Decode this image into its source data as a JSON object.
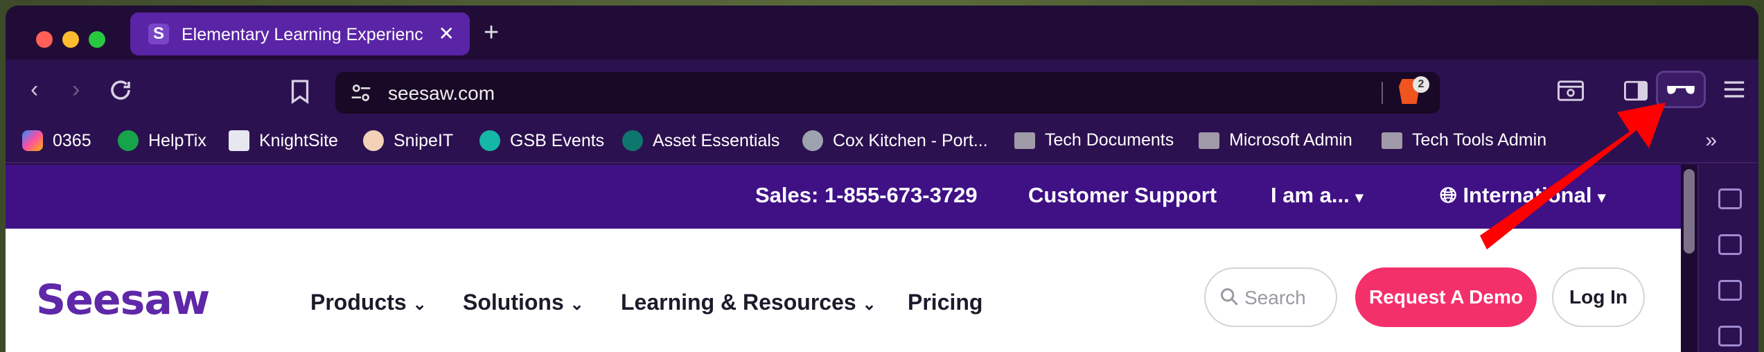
{
  "browser": {
    "tab": {
      "title": "Elementary Learning Experienc",
      "favicon": "seesaw-icon"
    },
    "new_tab_label": "+",
    "url": "seesaw.com",
    "shields_count": "2",
    "bookmarks": [
      {
        "label": "0365",
        "icon": "copilot-icon"
      },
      {
        "label": "HelpTix",
        "icon": "headset-icon"
      },
      {
        "label": "KnightSite",
        "icon": "knight-icon"
      },
      {
        "label": "SnipeIT",
        "icon": "snipeit-icon"
      },
      {
        "label": "GSB Events",
        "icon": "events-icon"
      },
      {
        "label": "Asset Essentials",
        "icon": "asset-icon"
      },
      {
        "label": "Cox Kitchen - Port...",
        "icon": "globe-icon"
      },
      {
        "label": "Tech Documents",
        "icon": "folder-icon"
      },
      {
        "label": "Microsoft Admin",
        "icon": "folder-icon"
      },
      {
        "label": "Tech Tools Admin",
        "icon": "folder-icon"
      }
    ],
    "more_bookmarks": "»"
  },
  "site": {
    "topbar": {
      "sales": "Sales: 1-855-673-3729",
      "support": "Customer Support",
      "iam": "I am a...",
      "international": "International"
    },
    "logo": "Seesaw",
    "nav": {
      "products": "Products",
      "solutions": "Solutions",
      "learning": "Learning & Resources",
      "pricing": "Pricing"
    },
    "search_placeholder": "Search",
    "demo": "Request A Demo",
    "login": "Log In"
  },
  "colors": {
    "brand_purple": "#3f1185",
    "cta_pink": "#f4306b",
    "arrow_red": "#ff0000"
  }
}
